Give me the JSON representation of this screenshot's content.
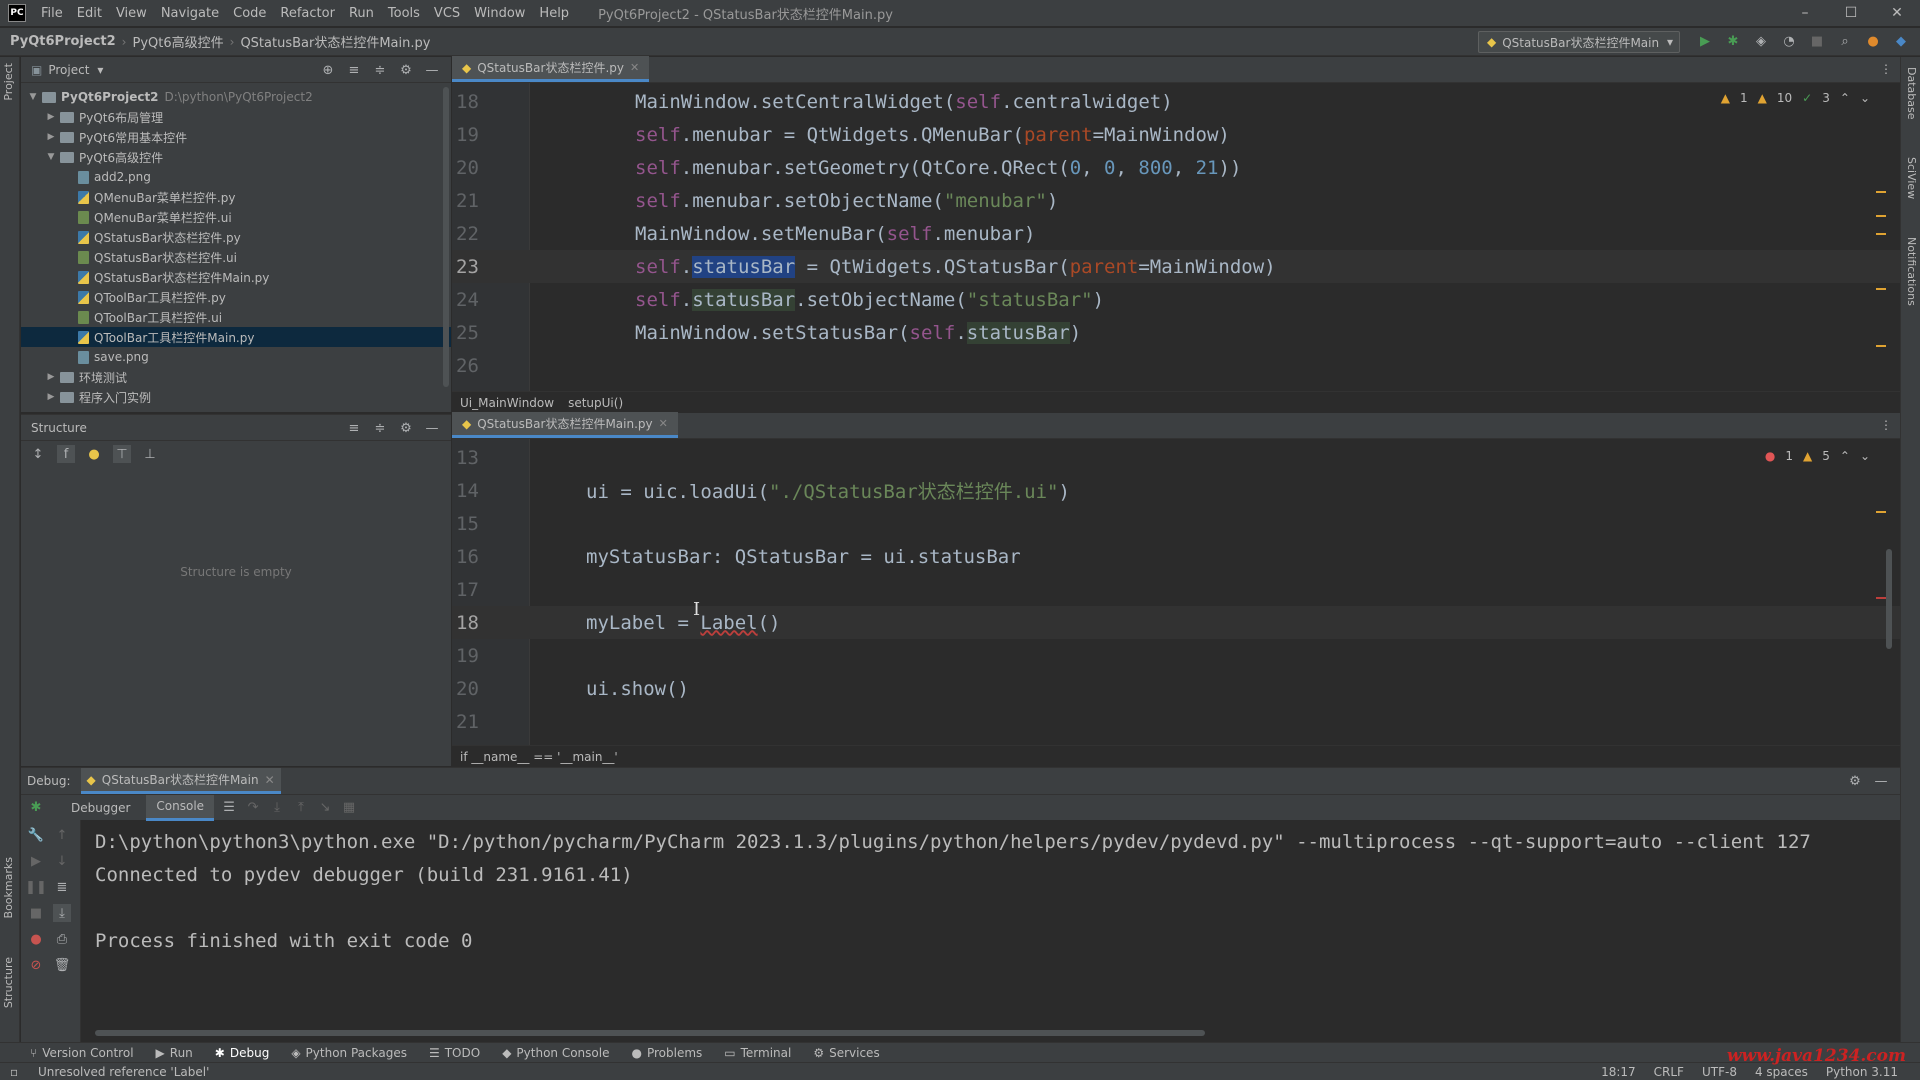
{
  "app": {
    "logo": "PC",
    "menu": [
      "File",
      "Edit",
      "View",
      "Navigate",
      "Code",
      "Refactor",
      "Run",
      "Tools",
      "VCS",
      "Window",
      "Help"
    ],
    "window_title": "PyQt6Project2 - QStatusBar状态栏控件Main.py"
  },
  "nav": {
    "crumbs": [
      "PyQt6Project2",
      "PyQt6高级控件",
      "QStatusBar状态栏控件Main.py"
    ],
    "run_config": "QStatusBar状态栏控件Main"
  },
  "left_strip": {
    "project": "Project",
    "bookmarks": "Bookmarks",
    "structure": "Structure"
  },
  "right_strip": {
    "database": "Database",
    "sciview": "SciView",
    "notifications": "Notifications"
  },
  "project_panel": {
    "title": "Project",
    "tree": [
      {
        "label": "PyQt6Project2",
        "path": "D:\\python\\PyQt6Project2",
        "level": 0,
        "type": "folder",
        "open": true
      },
      {
        "label": "PyQt6布局管理",
        "level": 1,
        "type": "folder",
        "open": false
      },
      {
        "label": "PyQt6常用基本控件",
        "level": 1,
        "type": "folder",
        "open": false
      },
      {
        "label": "PyQt6高级控件",
        "level": 1,
        "type": "folder",
        "open": true
      },
      {
        "label": "add2.png",
        "level": 2,
        "type": "png"
      },
      {
        "label": "QMenuBar菜单栏控件.py",
        "level": 2,
        "type": "py"
      },
      {
        "label": "QMenuBar菜单栏控件.ui",
        "level": 2,
        "type": "ui"
      },
      {
        "label": "QStatusBar状态栏控件.py",
        "level": 2,
        "type": "py"
      },
      {
        "label": "QStatusBar状态栏控件.ui",
        "level": 2,
        "type": "ui"
      },
      {
        "label": "QStatusBar状态栏控件Main.py",
        "level": 2,
        "type": "py"
      },
      {
        "label": "QToolBar工具栏控件.py",
        "level": 2,
        "type": "py"
      },
      {
        "label": "QToolBar工具栏控件.ui",
        "level": 2,
        "type": "ui"
      },
      {
        "label": "QToolBar工具栏控件Main.py",
        "level": 2,
        "type": "py",
        "selected": true
      },
      {
        "label": "save.png",
        "level": 2,
        "type": "png"
      },
      {
        "label": "环境测试",
        "level": 1,
        "type": "folder",
        "open": false
      },
      {
        "label": "程序入门实例",
        "level": 1,
        "type": "folder",
        "open": false
      }
    ]
  },
  "structure_panel": {
    "title": "Structure",
    "empty_text": "Structure is empty"
  },
  "editor_top": {
    "tab": "QStatusBar状态栏控件.py",
    "inspections": {
      "warn1": "1",
      "warn2": "10",
      "ok": "3"
    },
    "breadcrumb": [
      "Ui_MainWindow",
      "setupUi()"
    ],
    "lines": [
      {
        "num": "18",
        "html": "MainWindow.setCentralWidget(<span class=\"k-self\">self</span>.centralwidget)"
      },
      {
        "num": "19",
        "html": "<span class=\"k-self\">self</span>.menubar = QtWidgets.QMenuBar(<span class=\"k-param\">parent</span>=MainWindow)"
      },
      {
        "num": "20",
        "html": "<span class=\"k-self\">self</span>.menubar.setGeometry(QtCore.QRect(<span class=\"k-num\">0</span>, <span class=\"k-num\">0</span>, <span class=\"k-num\">800</span>, <span class=\"k-num\">21</span>))"
      },
      {
        "num": "21",
        "html": "<span class=\"k-self\">self</span>.menubar.setObjectName(<span class=\"k-str\">\"menubar\"</span>)"
      },
      {
        "num": "22",
        "html": "MainWindow.setMenuBar(<span class=\"k-self\">self</span>.menubar)"
      },
      {
        "num": "23",
        "html": "<span class=\"k-self\">self</span>.<span class=\"hl-sel\">statusBar</span> = QtWidgets.QStatusBar(<span class=\"k-param\">parent</span>=MainWindow)",
        "current": true
      },
      {
        "num": "24",
        "html": "<span class=\"k-self\">self</span>.<span class=\"hl-use\">statusBar</span>.setObjectName(<span class=\"k-str\">\"statusBar\"</span>)"
      },
      {
        "num": "25",
        "html": "MainWindow.setStatusBar(<span class=\"k-self\">self</span>.<span class=\"hl-use\">statusBar</span>)"
      },
      {
        "num": "26",
        "html": ""
      }
    ]
  },
  "editor_bottom": {
    "tab": "QStatusBar状态栏控件Main.py",
    "inspections": {
      "errors": "1",
      "warnings": "5"
    },
    "breadcrumb": [
      "if __name__ == '__main__'"
    ],
    "lines": [
      {
        "num": "13",
        "html": ""
      },
      {
        "num": "14",
        "html": "ui = uic.loadUi(<span class=\"k-str\">\"./QStatusBar状态栏控件.ui\"</span>)"
      },
      {
        "num": "15",
        "html": ""
      },
      {
        "num": "16",
        "html": "myStatusBar: QStatusBar = ui.statusBar"
      },
      {
        "num": "17",
        "html": ""
      },
      {
        "num": "18",
        "html": "myLabel = <span class=\"err-underline\">Label</span>()",
        "current": true
      },
      {
        "num": "19",
        "html": ""
      },
      {
        "num": "20",
        "html": "ui.show()"
      },
      {
        "num": "21",
        "html": ""
      }
    ]
  },
  "debug": {
    "label": "Debug:",
    "session": "QStatusBar状态栏控件Main",
    "tabs": [
      "Debugger",
      "Console"
    ],
    "console_lines": [
      "D:\\python\\python3\\python.exe \"D:/python/pycharm/PyCharm 2023.1.3/plugins/python/helpers/pydev/pydevd.py\" --multiprocess --qt-support=auto --client 127",
      "Connected to pydev debugger (build 231.9161.41)",
      "",
      "Process finished with exit code 0"
    ]
  },
  "tool_windows": [
    "Version Control",
    "Run",
    "Debug",
    "Python Packages",
    "TODO",
    "Python Console",
    "Problems",
    "Terminal",
    "Services"
  ],
  "status": {
    "message": "Unresolved reference 'Label'",
    "position": "18:17",
    "line_sep": "CRLF",
    "encoding": "UTF-8",
    "indent": "4 spaces",
    "interpreter": "Python 3.11"
  },
  "watermark": "www.java1234.com"
}
